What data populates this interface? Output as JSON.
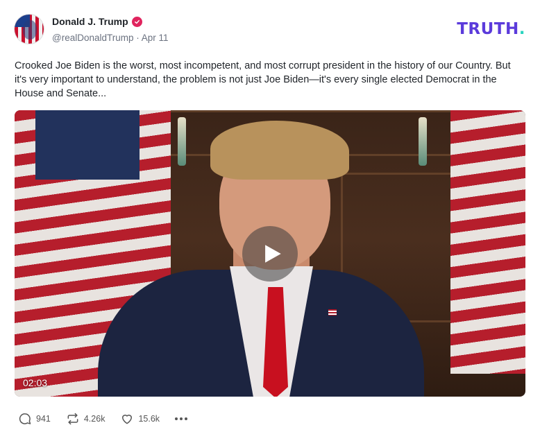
{
  "post": {
    "author_name": "Donald J. Trump",
    "handle": "@realDonaldTrump",
    "separator": "·",
    "date": "Apr 11",
    "text": "Crooked Joe Biden is the worst, most incompetent, and most corrupt president in the history of our Country. But it's very important to understand, the problem is not just Joe Biden—it's every single elected Democrat in the House and Senate...",
    "verified_icon": "verified-badge-icon",
    "verified_color": "#e0245e"
  },
  "brand": {
    "logo_text": "TRUTH",
    "logo_dot": ".",
    "logo_color": "#5b3bdb",
    "logo_dot_color": "#2ad4c0"
  },
  "video": {
    "duration": "02:03",
    "play_icon": "play-icon"
  },
  "actions": {
    "replies": "941",
    "retruths": "4.26k",
    "likes": "15.6k",
    "reply_icon": "comment-icon",
    "retruth_icon": "repost-icon",
    "like_icon": "heart-icon",
    "more_icon": "more-dots-icon"
  }
}
